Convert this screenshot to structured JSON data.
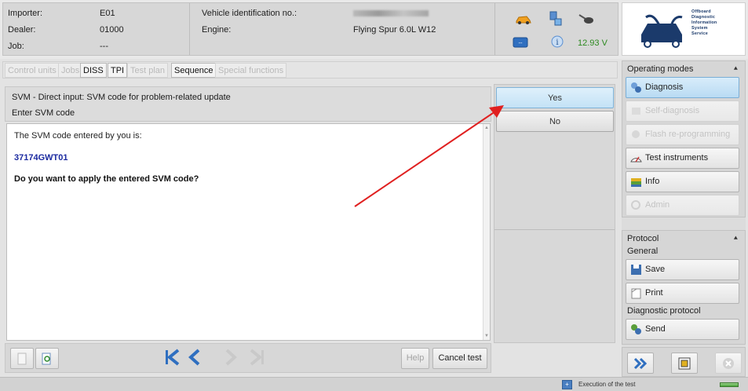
{
  "header": {
    "importer_label": "Importer:",
    "importer_value": "E01",
    "dealer_label": "Dealer:",
    "dealer_value": "01000",
    "job_label": "Job:",
    "job_value": "---",
    "vin_label": "Vehicle identification no.:",
    "engine_label": "Engine:",
    "engine_value": "Flying Spur 6.0L W12",
    "battery_voltage": "12.93 V",
    "logo_lines": [
      "Offboard",
      "Diagnostic",
      "Information",
      "System",
      "Service"
    ]
  },
  "tabs": [
    {
      "label": "Control units",
      "enabled": false
    },
    {
      "label": "Jobs",
      "enabled": false
    },
    {
      "label": "DISS",
      "enabled": true
    },
    {
      "label": "TPI",
      "enabled": true
    },
    {
      "label": "Test plan",
      "enabled": false
    },
    {
      "label": "Sequence",
      "enabled": true
    },
    {
      "label": "Special functions",
      "enabled": false
    }
  ],
  "panel": {
    "title": "SVM - Direct input: SVM code for problem-related update",
    "subtitle": "Enter SVM code",
    "line1": "The SVM code entered by you is:",
    "svm_code": "37174GWT01",
    "question": "Do you want to apply the entered SVM code?"
  },
  "answers": {
    "yes": "Yes",
    "no": "No"
  },
  "bottombar": {
    "help": "Help",
    "cancel": "Cancel test"
  },
  "sidebar": {
    "operating_modes_title": "Operating modes",
    "modes": [
      {
        "label": "Diagnosis",
        "state": "active",
        "icon": "diagnosis-icon"
      },
      {
        "label": "Self-diagnosis",
        "state": "disabled",
        "icon": "self-diagnosis-icon"
      },
      {
        "label": "Flash re-programming",
        "state": "disabled",
        "icon": "flash-icon"
      },
      {
        "label": "Test instruments",
        "state": "enabled",
        "icon": "test-instruments-icon"
      },
      {
        "label": "Info",
        "state": "enabled",
        "icon": "info-book-icon"
      },
      {
        "label": "Admin",
        "state": "disabled",
        "icon": "admin-icon"
      }
    ],
    "protocol_title": "Protocol",
    "general_label": "General",
    "save": "Save",
    "print": "Print",
    "diagnostic_protocol_label": "Diagnostic protocol",
    "send": "Send"
  },
  "status": {
    "text": "Execution of the test"
  },
  "colors": {
    "accent": "#1b2aa0",
    "arrow": "#e02020",
    "active_button": "#c3e2f6"
  }
}
